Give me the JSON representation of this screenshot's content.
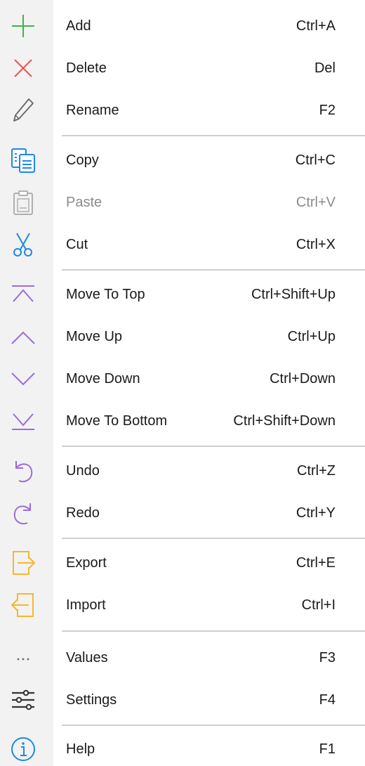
{
  "menu": {
    "items": [
      {
        "label": "Add",
        "shortcut": "Ctrl+A",
        "icon": "plus-icon",
        "color": "#3cb44b"
      },
      {
        "label": "Delete",
        "shortcut": "Del",
        "icon": "close-icon",
        "color": "#ef5350"
      },
      {
        "label": "Rename",
        "shortcut": "F2",
        "icon": "pencil-icon",
        "color": "#666666"
      },
      {
        "label": "Copy",
        "shortcut": "Ctrl+C",
        "icon": "copy-icon",
        "color": "#1e88e5"
      },
      {
        "label": "Paste",
        "shortcut": "Ctrl+V",
        "icon": "clipboard-icon",
        "color": "#b0b0b0",
        "disabled": true
      },
      {
        "label": "Cut",
        "shortcut": "Ctrl+X",
        "icon": "scissors-icon",
        "color": "#1e88e5"
      },
      {
        "label": "Move To Top",
        "shortcut": "Ctrl+Shift+Up",
        "icon": "move-to-top-icon",
        "color": "#9c6ade"
      },
      {
        "label": "Move Up",
        "shortcut": "Ctrl+Up",
        "icon": "chevron-up-icon",
        "color": "#9c6ade"
      },
      {
        "label": "Move Down",
        "shortcut": "Ctrl+Down",
        "icon": "chevron-down-icon",
        "color": "#9c6ade"
      },
      {
        "label": "Move To Bottom",
        "shortcut": "Ctrl+Shift+Down",
        "icon": "move-to-bottom-icon",
        "color": "#9c6ade"
      },
      {
        "label": "Undo",
        "shortcut": "Ctrl+Z",
        "icon": "undo-icon",
        "color": "#9c6ade"
      },
      {
        "label": "Redo",
        "shortcut": "Ctrl+Y",
        "icon": "redo-icon",
        "color": "#9c6ade"
      },
      {
        "label": "Export",
        "shortcut": "Ctrl+E",
        "icon": "export-icon",
        "color": "#f5b82e"
      },
      {
        "label": "Import",
        "shortcut": "Ctrl+I",
        "icon": "import-icon",
        "color": "#f5b82e"
      },
      {
        "label": "Values",
        "shortcut": "F3",
        "icon": "ellipsis-icon",
        "color": "#666666"
      },
      {
        "label": "Settings",
        "shortcut": "F4",
        "icon": "sliders-icon",
        "color": "#333333"
      },
      {
        "label": "Help",
        "shortcut": "F1",
        "icon": "info-icon",
        "color": "#1e88e5"
      }
    ]
  }
}
